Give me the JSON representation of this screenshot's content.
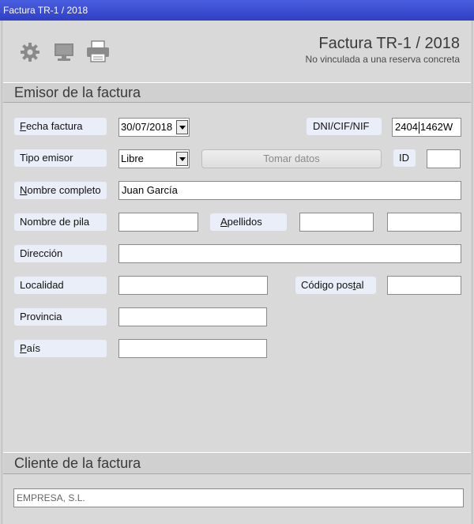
{
  "window": {
    "title": "Factura TR-1 / 2018"
  },
  "toolbar": {
    "icons": [
      "gear-icon",
      "monitor-icon",
      "printer-icon"
    ]
  },
  "header": {
    "title": "Factura TR-1 / 2018",
    "subtitle": "No vinculada a una reserva concreta"
  },
  "emisor": {
    "section_title": "Emisor de la factura",
    "fecha_label_u": "F",
    "fecha_label_rest": "echa factura",
    "fecha_value": "30/07/2018",
    "dni_label": "DNI/CIF/NIF",
    "dni_value_a": "2404",
    "dni_value_b": "1462W",
    "tipo_label": "Tipo emisor",
    "tipo_value": "Libre",
    "tomar_datos": "Tomar datos",
    "id_label": "ID",
    "id_value": "",
    "nombre_completo_label_u": "N",
    "nombre_completo_label_rest": "ombre completo",
    "nombre_completo_value": "Juan García",
    "nombre_pila_label": "Nombre de pila",
    "nombre_pila_value": "",
    "apellidos_label_u": "A",
    "apellidos_label_rest": "pellidos",
    "apellido1_value": "",
    "apellido2_value": "",
    "direccion_label": "Dirección",
    "direccion_value": "",
    "localidad_label": "Localidad",
    "localidad_value": "",
    "cp_label_pre": "Código pos",
    "cp_label_u": "t",
    "cp_label_post": "al",
    "cp_value": "",
    "provincia_label": "Provincia",
    "provincia_value": "",
    "pais_label_u": "P",
    "pais_label_rest": "aís",
    "pais_value": ""
  },
  "cliente": {
    "section_title": "Cliente de la factura",
    "value": "EMPRESA, S.L."
  }
}
